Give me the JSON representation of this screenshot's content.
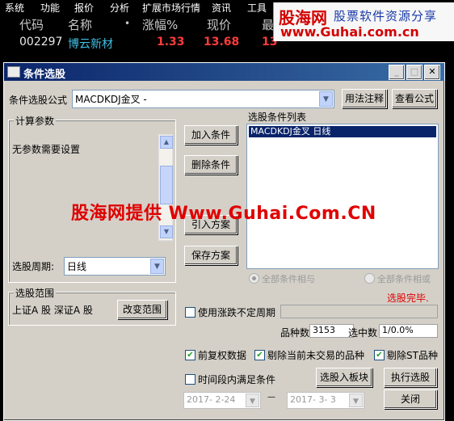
{
  "menubar": {
    "items": [
      "系统",
      "功能",
      "报价",
      "分析",
      "扩展市场行情",
      "资讯",
      "工具"
    ]
  },
  "quote": {
    "headers": {
      "code": "代码",
      "name": "名称",
      "dot": "•",
      "change": "涨幅%",
      "price": "现价",
      "more": "最"
    },
    "row": {
      "code": "002297",
      "name": "博云新材",
      "change": "1.33",
      "price": "13.68",
      "partial": "13"
    }
  },
  "banner": {
    "brand": "股海网",
    "sub": "股票软件资源分享",
    "url": "www.Guhai.com.cn"
  },
  "watermark": "股海网提供 Www.Guhai.Com.CN",
  "dialog": {
    "title": "条件选股",
    "controls": {
      "min": "_",
      "max": "□",
      "close": "✕"
    },
    "formula_label": "条件选股公式",
    "formula_value": "MACDKDJ金叉  -",
    "usage_button": "用法注释",
    "view_button": "查看公式",
    "params_group": "计算参数",
    "params_text": "无参数需要设置",
    "period_label": "选股周期:",
    "period_value": "日线",
    "add_button": "加入条件",
    "delete_button": "删除条件",
    "import_button": "引入方案",
    "save_button": "保存方案",
    "conditions_label": "选股条件列表",
    "conditions": [
      "MACDKDJ金叉  日线"
    ],
    "radio_and": "全部条件相与",
    "radio_or": "全部条件相或",
    "status": "选股完毕.",
    "range_group": "选股范围",
    "range_text": "上证A 股  深证A 股",
    "change_range_button": "改变范围",
    "use_period_label": "使用涨跌不定周期",
    "count_label": "品种数",
    "count_value": "3153",
    "selected_label": "选中数",
    "selected_value": "1/0.0%",
    "chk_prefix": "前复权数据",
    "chk_exclude_untraded": "剔除当前未交易的品种",
    "chk_exclude_st": "剔除ST品种",
    "time_cond_label": "时间段内满足条件",
    "to_block_button": "选股入板块",
    "run_button": "执行选股",
    "date_from": "2017- 2-24",
    "date_dash": "—",
    "date_to": "2017- 3- 3",
    "close_button": "关闭",
    "colors": {
      "status": "#e00000",
      "title_bar": "#0a246a",
      "check": "#21a121"
    }
  }
}
